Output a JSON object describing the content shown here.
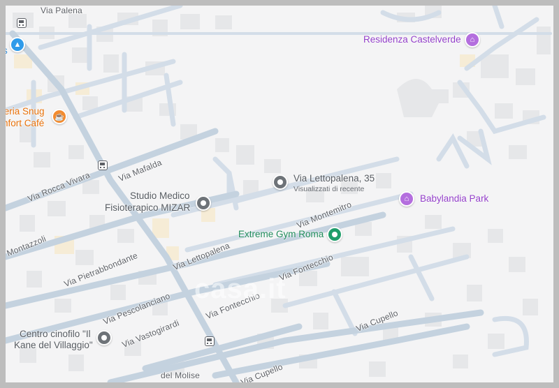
{
  "map": {
    "streets": {
      "via_palena": "Via Palena",
      "via_rocca_vivara": "Via Rocca Vivara",
      "via_mafalda": "Via Mafalda",
      "montazzoli": "Montazzoli",
      "via_pietrabbondante": "Via Pietrabbondante",
      "via_lettopalena": "Via Lettopalena",
      "via_montemitro": "Via Montemitro",
      "via_fontecchio_1": "Via Fontecchio",
      "via_fontecchio_2": "Via Fontecchio",
      "via_pescolanciano": "Via Pescolanciano",
      "via_vastogirardi": "Via Vastogirardi",
      "via_cupello_1": "Via Cupello",
      "via_cupello_2": "Via Cupello",
      "del_molise": "del Molise"
    },
    "places": {
      "residenza": "Residenza Castelverde",
      "babylandia": "Babylandia Park",
      "via_lettopalena_35": "Via Lettopalena, 35",
      "recently_viewed": "Visualizzati di recente",
      "studio_line1": "Studio Medico",
      "studio_line2": "Fisioterapico MIZAR",
      "gym": "Extreme Gym Roma",
      "cafe_line1": "teria Snug",
      "cafe_line2": "nfort Café",
      "cinofilo_line1": "Centro cinofilo \"Il",
      "cinofilo_line2": "Kane del Villaggio\"",
      "partial_top_left": "i",
      "partial_top_left2": "s"
    },
    "watermark": "casa.it",
    "colors": {
      "background": "#f4f4f5",
      "road": "#c9d6e3",
      "road_major": "#c2d1df",
      "building": "#e6e7e9",
      "building_yellow": "#f6ecd6",
      "poi_purple": "#9340c9",
      "poi_green": "#1f8a5a",
      "poi_orange": "#e8710a"
    },
    "icons": [
      "bus-stop-icon",
      "place-pin-icon",
      "landmark-icon",
      "gym-icon",
      "cafe-icon",
      "shopping-icon"
    ]
  }
}
